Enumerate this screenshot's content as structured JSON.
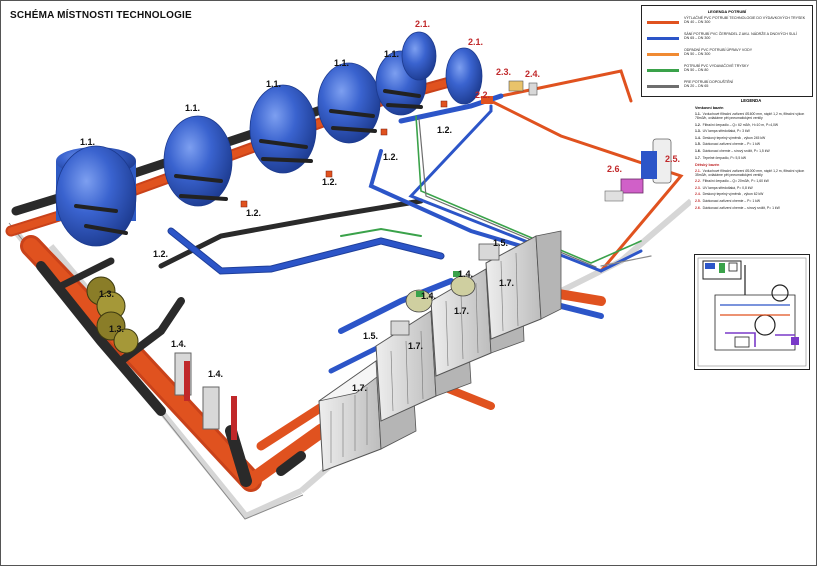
{
  "title": "SCHÉMA MÍSTNOSTI TECHNOLOGIE",
  "colors": {
    "tank_blue": "#2f5bc4",
    "pipe_orange": "#e0521f",
    "pipe_blue": "#2c55c8",
    "pipe_green": "#3aa24a",
    "pipe_grey": "#6e6e6e",
    "frame_grey": "#d6d6d6",
    "label_red": "#c0282a"
  },
  "labels": {
    "l11a": "1.1.",
    "l11b": "1.1.",
    "l11c": "1.1.",
    "l11d": "1.1.",
    "l11e": "1.1.",
    "l12a": "1.2.",
    "l12b": "1.2.",
    "l12c": "1.2.",
    "l12d": "1.2.",
    "l12e": "1.2.",
    "l13a": "1.3.",
    "l13b": "1.3.",
    "l14a": "1.4.",
    "l14b": "1.4.",
    "l14c": "1.4.",
    "l14d": "1.4.",
    "l15a": "1.5.",
    "l15b": "1.5.",
    "l17a": "1.7.",
    "l17b": "1.7.",
    "l17c": "1.7.",
    "l17d": "1.7.",
    "l21a": "2.1.",
    "l21b": "2.1.",
    "l22": "2.2.",
    "l23": "2.3.",
    "l24": "2.4.",
    "l25": "2.5.",
    "l26": "2.6."
  },
  "legend_pipes": {
    "heading": "LEGENDA POTRUBÍ",
    "rows": [
      {
        "color": "#e0521f",
        "text": "VÝTLAČNÉ PVC POTRUBÍ TECHNOLOGIE DO VÝDAVKOVÝCH TRYSEK",
        "size": "DN 40 – DN 300"
      },
      {
        "color": "#2c55c8",
        "text": "SÁNÍ POTRUBÍ PVC ČERPADEL Z AKU. NÁDRŽE A DNOVÝCH SULÍ",
        "size": "DN 65 – DN 300"
      },
      {
        "color": "#f08a32",
        "text": "ODPADNÍ PVC POTRUBÍ ÚPRAVY VODY",
        "size": "DN 50 – DN 300"
      },
      {
        "color": "#3aa24a",
        "text": "POTRUBÍ PVC VYDAVAČOVÉ TRYSKY",
        "size": "DN 50 – DN 80"
      },
      {
        "color": "#6e6e6e",
        "text": "PRE POTRUBÍ DOPOUŠTĚNÍ",
        "size": "DN 20 – DN 65"
      }
    ]
  },
  "legend_items": {
    "heading": "LEGENDA",
    "section1": "Venkovní bazén",
    "items1": [
      {
        "code": "1.1.",
        "text": "Vzduchové filtrační zařízení Ø1600 mm, náplň 1,2 m, filtrační výkon 78m3/h, ovládáme pět pneumatickými ventily"
      },
      {
        "code": "1.2.",
        "text": "Filtrační čerpadlo – Q= 62 m3/h, H=10 m, P=4,0W"
      },
      {
        "code": "1.3.",
        "text": "UV lampa středotlaká, P= 3 kW"
      },
      {
        "code": "1.4.",
        "text": "Deskový tepelný výměník , výkon 245 kW"
      },
      {
        "code": "1.5.",
        "text": "Dávkovací zařízení chemie – P= 1 kW"
      },
      {
        "code": "1.6.",
        "text": "Dávkovací chemie – sírový snížit, P= 1,5 kW"
      },
      {
        "code": "1.7.",
        "text": "Tepelné čerpadlo, P= 5,5 kW"
      }
    ],
    "section2": "Dětský bazén",
    "items2": [
      {
        "code": "2.1.",
        "text": "Vzduchové filtrační zařízení Ø1000 mm, náplň 1,2 m, filtrační výkon 35m3/h, ovládáme pět pneumatickými ventily"
      },
      {
        "code": "2.2.",
        "text": "Filtrační čerpadlo – Q= 20m3/h, P= 1,60 kW"
      },
      {
        "code": "2.3.",
        "text": "UV lampa středotlaká, P= 0,8 kW"
      },
      {
        "code": "2.4.",
        "text": "Deskový tepelný výměník , výkon 62 kW"
      },
      {
        "code": "2.5.",
        "text": "Dávkovací zařízení chemie – P= 1 kW"
      },
      {
        "code": "2.6.",
        "text": "Dávkovací zařízení chemie – sírový snížit, P= 1 kW"
      }
    ]
  }
}
